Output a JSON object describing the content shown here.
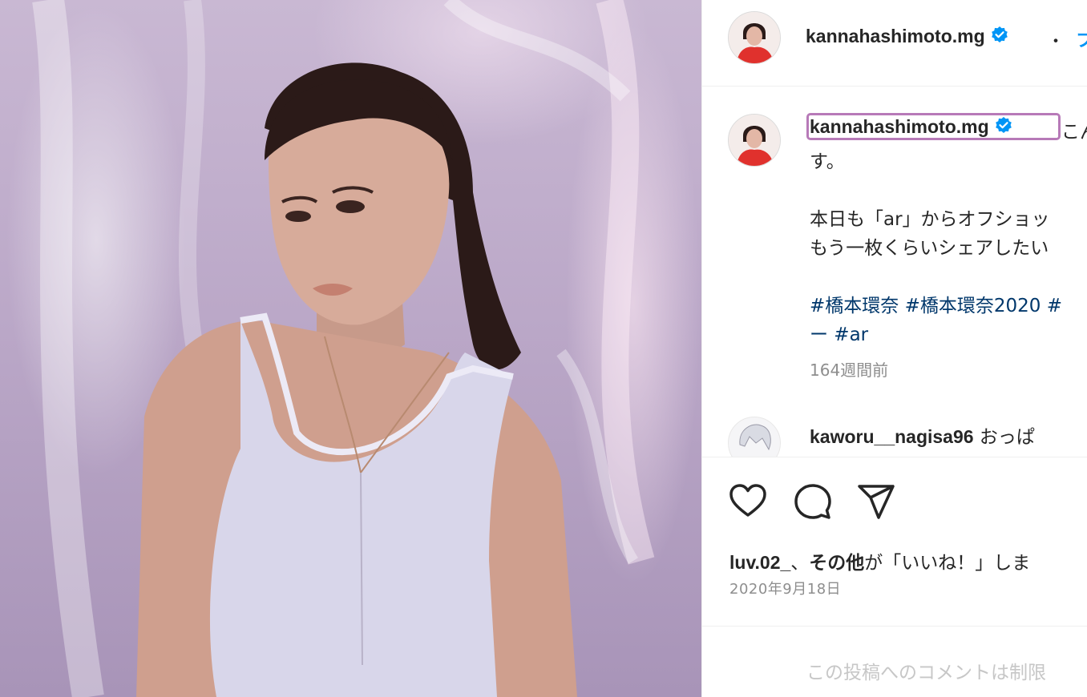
{
  "post": {
    "author": "kannahashimoto.mg",
    "follow_separator": "・",
    "follow_label": "フ",
    "caption_user": "kannahashimoto.mg",
    "caption_first": "こん",
    "caption_line2": "す。",
    "caption_line3": "本日も「ar」からオフショッ",
    "caption_line4": "もう一枚くらいシェアしたい",
    "hashtags_line1": "#橋本環奈 #橋本環奈2020 #",
    "hashtags_line2": "ー #ar",
    "time_ago": "164週間前",
    "date": "2020年9月18日"
  },
  "reply": {
    "user": "kaworu__nagisa96",
    "text": "おっぱ"
  },
  "likes": {
    "user": "luv.02_",
    "separator": "、",
    "others": "その他",
    "suffix": "が「いいね！」しま"
  },
  "comments_disabled": "この投稿へのコメントは制限",
  "colors": {
    "link_blue": "#00376b",
    "verified_blue": "#0095f6",
    "highlight_border": "#b77ab8",
    "muted_text": "#8e8e8e"
  },
  "icons": {
    "like": "heart-icon",
    "comment": "comment-bubble-icon",
    "share": "paper-plane-icon",
    "verified": "verified-badge-icon"
  }
}
